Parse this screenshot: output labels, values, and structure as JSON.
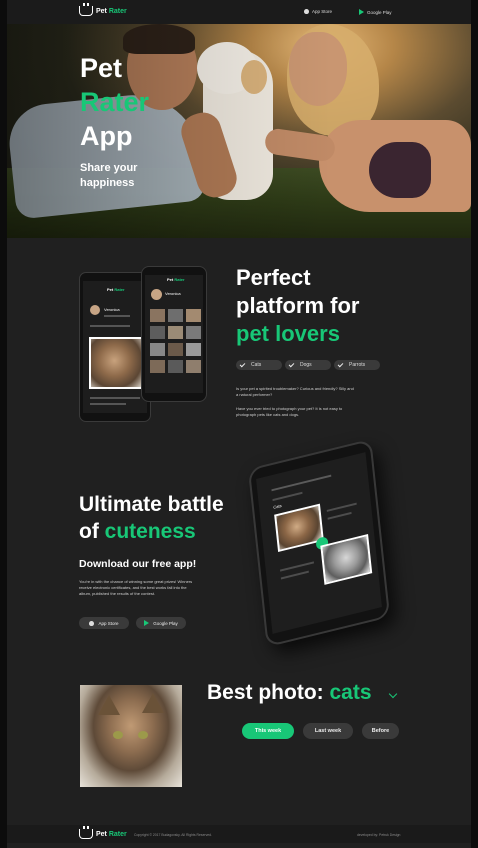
{
  "brand": {
    "name_part1": "Pet",
    "name_part2": "Rater",
    "accent": "#18c777"
  },
  "header": {
    "app_store": "App Store",
    "google_play": "Google Play"
  },
  "hero": {
    "title_line1": "Pet",
    "title_line2": "Rater",
    "title_line3": "App",
    "subtitle": "Share your happiness"
  },
  "platform": {
    "title_line1": "Perfect",
    "title_line2": "platform for",
    "title_line3": "pet lovers",
    "chips": [
      "Cats",
      "Dogs",
      "Parrots"
    ],
    "para1": "Is your pet a spirited troublemaker? Curious and friendly? Silly and a natural performer?",
    "para2": "Have you ever tried to photograph your pet? It is not easy to photograph pets like cats and dogs.",
    "phone_user": "Veronica"
  },
  "battle": {
    "title_line1": "Ultimate battle",
    "title_of": "of",
    "title_accent": "cuteness",
    "subtitle": "Download our free app!",
    "para": "You're in with the chance of winning some great prizes! Winners receive electronic certificates, and the best works fall into the album, published the results of the contest.",
    "btn_app_store": "App Store",
    "btn_google_play": "Google Play",
    "phone_category": "Cats"
  },
  "best": {
    "title_prefix": "Best photo:",
    "title_accent": "cats",
    "filters": [
      "This week",
      "Last week",
      "Before"
    ]
  },
  "footer": {
    "copyright": "Copyright © 2017 Budagovsky. All Rights Reserved.",
    "developer": "developed by: Petruk Design"
  }
}
